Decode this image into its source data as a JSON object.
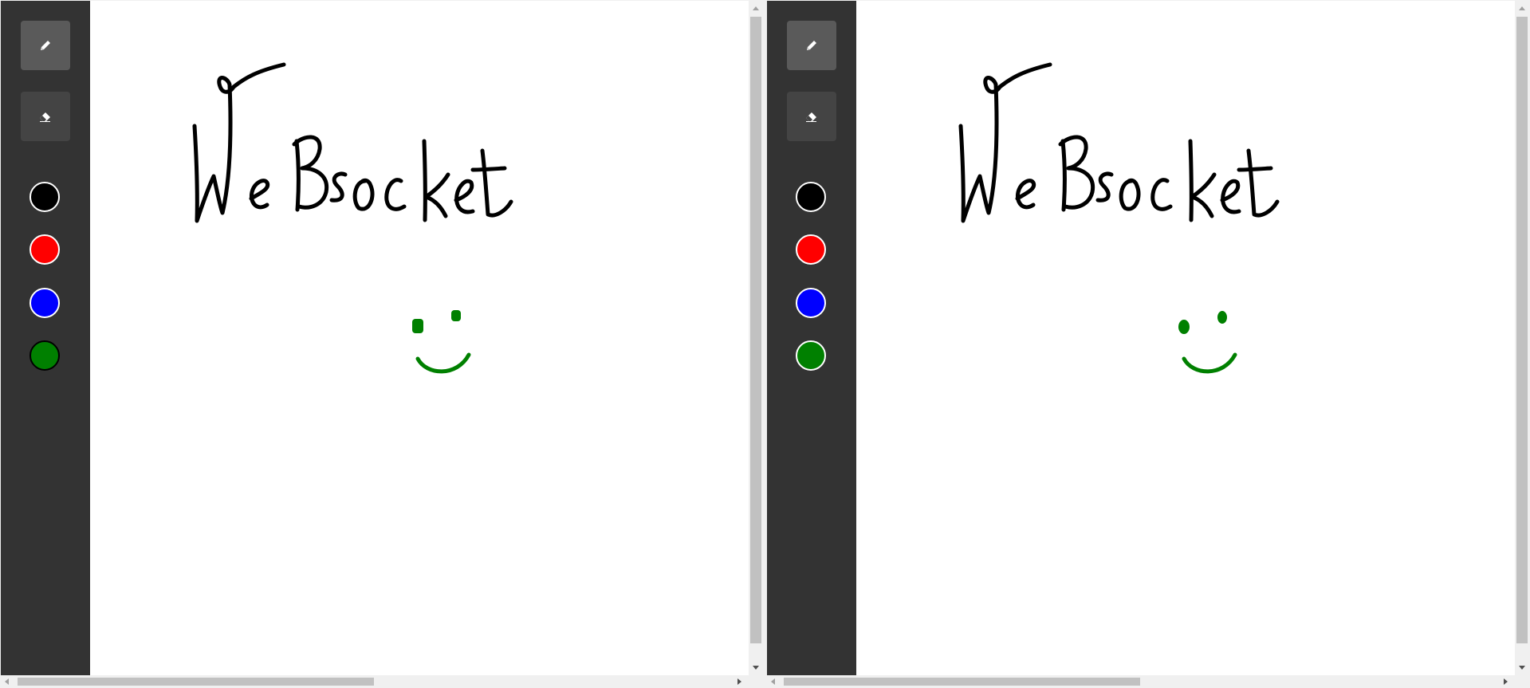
{
  "windows": [
    {
      "id": "left",
      "tools": [
        {
          "name": "pencil-icon",
          "active": true
        },
        {
          "name": "eraser-icon",
          "active": false
        }
      ],
      "palette": [
        "#000000",
        "#ff0000",
        "#0000ff",
        "#008000"
      ],
      "selected_color": "#008000"
    },
    {
      "id": "right",
      "tools": [
        {
          "name": "pencil-icon",
          "active": true
        },
        {
          "name": "eraser-icon",
          "active": false
        }
      ],
      "palette": [
        "#000000",
        "#ff0000",
        "#0000ff",
        "#008000"
      ],
      "selected_color": "#000000"
    }
  ],
  "drawing": {
    "handwriting_text": "WeBsocket",
    "handwriting_color": "#000000",
    "smiley_color": "#008000"
  }
}
